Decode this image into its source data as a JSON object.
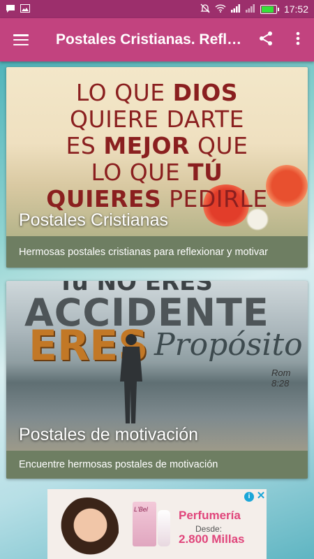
{
  "status_bar": {
    "left_icons": [
      "chat-icon",
      "image-icon"
    ],
    "right_icons": [
      "mute-icon",
      "wifi-icon",
      "signal-icon",
      "signal-icon-2",
      "battery-icon"
    ],
    "time": "17:52"
  },
  "app_bar": {
    "title": "Postales Cristianas. Refl…",
    "icons": [
      "menu-icon",
      "share-icon",
      "more-vert-icon"
    ]
  },
  "cards": [
    {
      "title": "Postales Cristianas",
      "description": "Hermosas postales cristianas para reflexionar y motivar",
      "image_text": {
        "line1a": "LO QUE ",
        "line1b": "DIOS",
        "line2": "QUIERE DARTE",
        "line3a": "ES ",
        "line3b": "MEJOR",
        "line3c": " QUE",
        "line4a": "LO QUE ",
        "line4b": "TÚ",
        "line5a": "QUIERES",
        "line5b": " PEDIRLE"
      }
    },
    {
      "title": "Postales de motivación",
      "description": "Encuentre hermosas postales de motivación",
      "image_text": {
        "top": "Tú NO ERES",
        "accidente": "ACCIDENTE",
        "eres": "ERES",
        "proposito": "Propósito",
        "ref": "Rom 8:28"
      }
    }
  ],
  "ad": {
    "brand": "L'Bel",
    "headline": "Perfumería",
    "sub": "Desde:",
    "price": "2.800 Millas"
  },
  "colors": {
    "status_bar": "#9c2f6c",
    "app_bar": "#c2437f",
    "card_footer": "#6e7e62"
  }
}
